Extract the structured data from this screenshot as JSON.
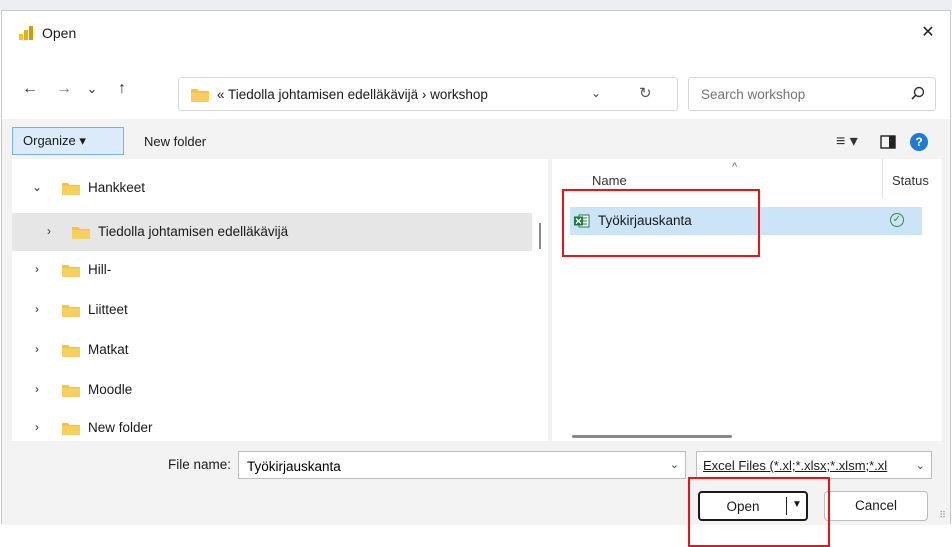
{
  "window": {
    "title": "Open",
    "close_glyph": "✕"
  },
  "nav": {
    "back_glyph": "←",
    "forward_glyph": "→",
    "recent_glyph": "⌄",
    "up_glyph": "↑",
    "address_prefix": "«",
    "address_path": [
      "Tiedolla johtamisen edelläkävijä",
      "workshop"
    ],
    "address_text": "«  Tiedolla johtamisen edelläkävijä  ›  workshop",
    "address_dropdown_glyph": "⌄",
    "refresh_glyph": "↻",
    "search_placeholder": "Search workshop"
  },
  "toolbar": {
    "organize_label": "Organize ▾",
    "new_folder_label": "New folder",
    "view_glyph": "≡ ▾",
    "help_glyph": "?"
  },
  "tree": {
    "items": [
      {
        "label": "Hankkeet",
        "chevron": "⌄",
        "selected": false,
        "indent": 0
      },
      {
        "label": "Tiedolla johtamisen edelläkävijä",
        "chevron": "›",
        "selected": true,
        "indent": 1
      },
      {
        "label": "Hill-",
        "chevron": "›",
        "selected": false,
        "indent": 0
      },
      {
        "label": "Liitteet",
        "chevron": "›",
        "selected": false,
        "indent": 0
      },
      {
        "label": "Matkat",
        "chevron": "›",
        "selected": false,
        "indent": 0
      },
      {
        "label": "Moodle",
        "chevron": "›",
        "selected": false,
        "indent": 0
      },
      {
        "label": "New folder",
        "chevron": "›",
        "selected": false,
        "indent": 0
      }
    ]
  },
  "files": {
    "columns": {
      "name": "Name",
      "status": "Status",
      "sort_glyph": "^"
    },
    "rows": [
      {
        "name": "Työkirjauskanta",
        "status_glyph": "✓"
      }
    ]
  },
  "bottom": {
    "file_name_label": "File name:",
    "file_name_value": "Työkirjauskanta",
    "file_name_dropdown_glyph": "⌄",
    "filter_label": "Excel Files (*.xl;*.xlsx;*.xlsm;*.xl",
    "filter_dropdown_glyph": "⌄",
    "open_label": "Open",
    "open_split_glyph": "▼",
    "cancel_label": "Cancel",
    "grip_glyph": "⠿"
  },
  "colors": {
    "accent": "#1e7ad6",
    "selection": "#cce4f7",
    "highlight_box": "#e8141a",
    "folder": "#f5c242",
    "excel": "#1d7a3e"
  }
}
